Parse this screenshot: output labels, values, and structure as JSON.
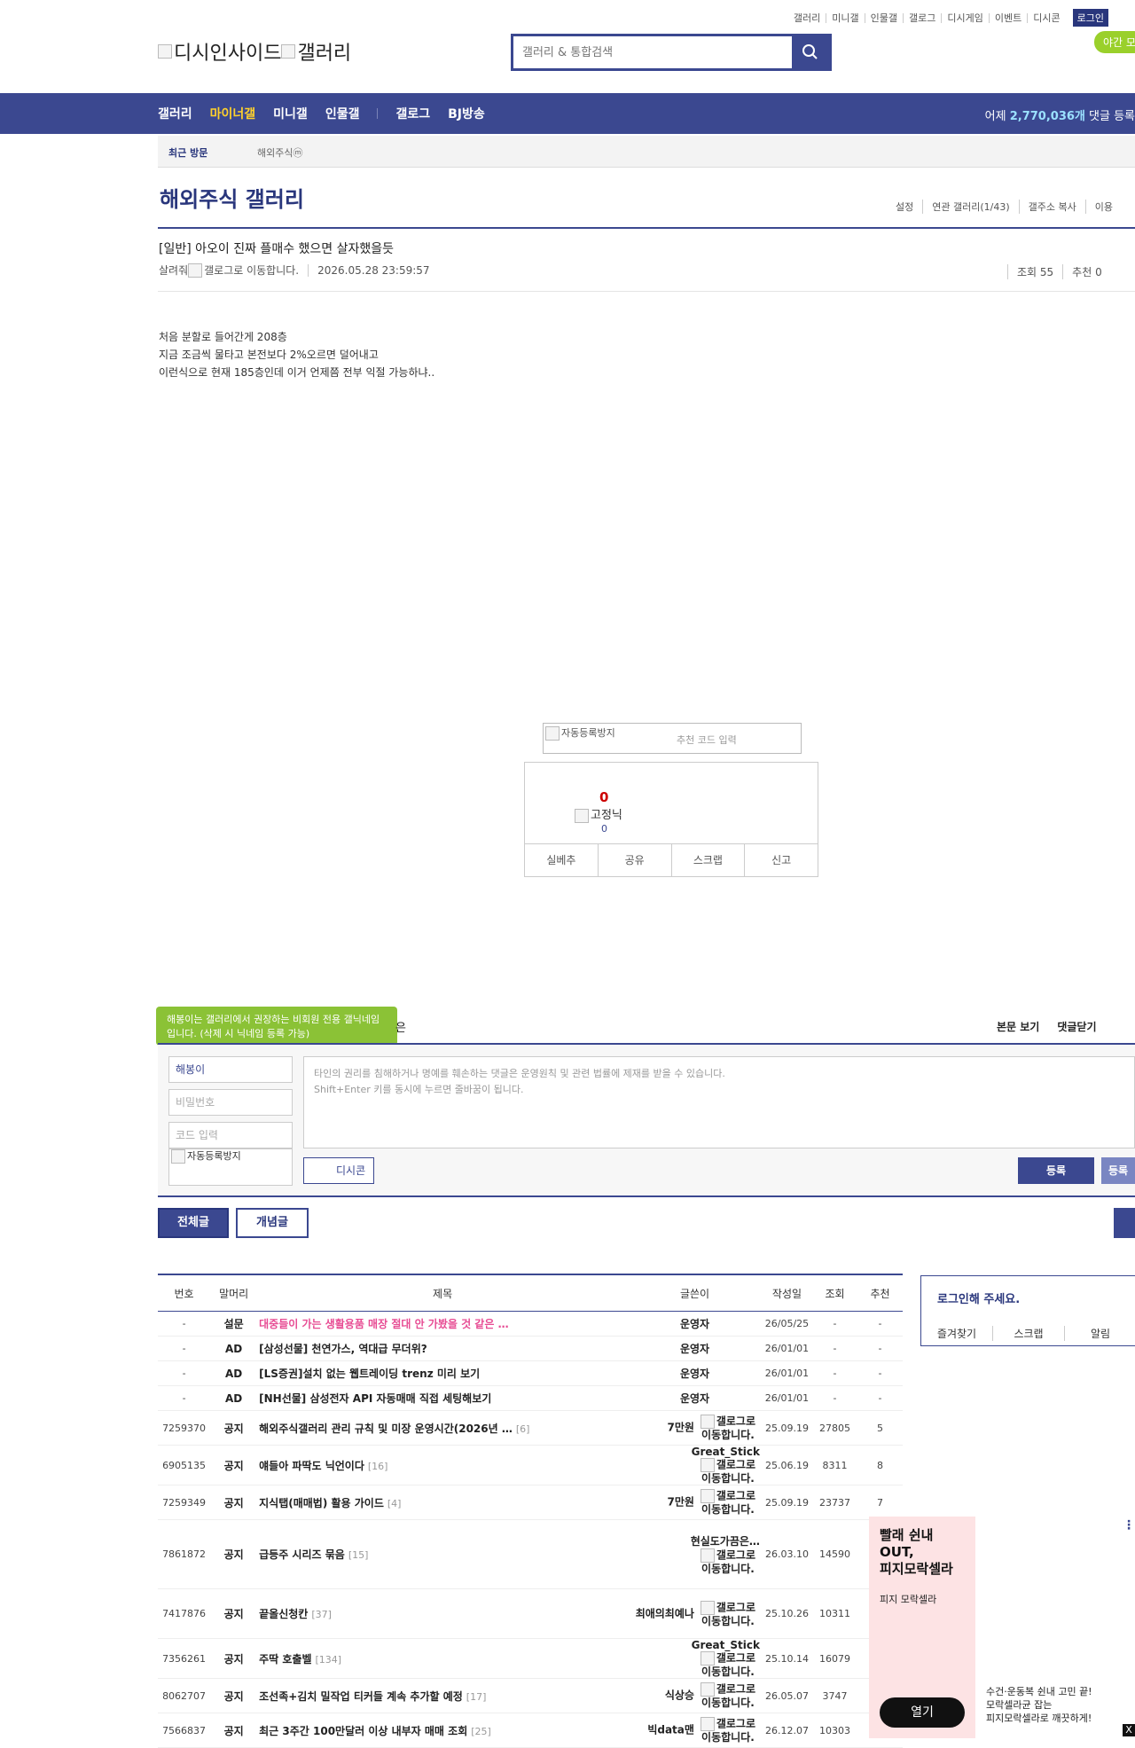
{
  "util_links": [
    "갤러리",
    "미니갤",
    "인물갤",
    "갤로그",
    "디시게임",
    "이벤트",
    "디시콘"
  ],
  "login_label": "로그인",
  "night_mode": "야간 모",
  "logo": {
    "left": "디시인사이드",
    "right": "갤러리"
  },
  "search": {
    "placeholder": "갤러리 & 통합검색"
  },
  "gnb": {
    "items": [
      "갤러리",
      "마이너갤",
      "미니갤",
      "인물갤",
      "갤로그",
      "BJ방송"
    ],
    "active": "마이너갤",
    "count_prefix": "어제 ",
    "count_value": "2,770,036개",
    "count_suffix": " 댓글 등록"
  },
  "recent_visit": {
    "label": "최근 방문",
    "gallery": "해외주식ⓜ"
  },
  "gallery": {
    "title": "해외주식 갤러리",
    "options": [
      "설정",
      "연관 갤러리(1/43)",
      "갤주소 복사",
      "이용"
    ]
  },
  "post": {
    "title": "[일반] 아오이 진짜 플매수 했으면 살자했을듯",
    "author": "살려줘",
    "author_icon_alt": "갤로그로 이동합니다.",
    "date": "2026.05.28 23:59:57",
    "views": "조회 55",
    "recommends": "추천 0",
    "body": [
      "처음 분할로 들어간게 208층",
      "지금 조금씩 물타고 본전보다 2%오르면 덜어내고",
      "이런식으로 현재 185층인데 이거 언제쯤 전부 익절 가능하냐.."
    ]
  },
  "captcha": {
    "img_alt": "자동등록방지",
    "placeholder": "추천 코드 입력"
  },
  "recommend": {
    "count": "0",
    "fixed_label": "고정닉",
    "fixed_count": "0",
    "buttons": [
      "실베추",
      "공유",
      "스크랩",
      "신고"
    ]
  },
  "comment": {
    "tooltip": "해봉이는 갤러리에서 권장하는 비회원 전용 갤닉네임입니다. (삭제 시 닉네임 등록 가능)",
    "tail": "은",
    "right_links": [
      "본문 보기",
      "댓글닫기"
    ],
    "nickname_value": "해봉이",
    "password_placeholder": "비밀번호",
    "code_placeholder": "코드 입력",
    "captcha_alt": "자동등록방지",
    "textarea_line1": "타인의 권리를 침해하거나 명예를 훼손하는 댓글은 운영원칙 및 관련 법률에 제재를 받을 수 있습니다.",
    "textarea_line2": "Shift+Enter 키를 동시에 누르면 줄바꿈이 됩니다.",
    "dccon_label": "디시콘",
    "register_label": "등록",
    "register2_label": "등록"
  },
  "list_tabs": {
    "all": "전체글",
    "concept": "개념글"
  },
  "list": {
    "headers": [
      "번호",
      "말머리",
      "제목",
      "글쓴이",
      "작성일",
      "조회",
      "추천"
    ],
    "rows": [
      {
        "no": "-",
        "head": "설문",
        "subject": "대중들이 가는 생활용품 매장 절대 안 가봤을 것 같은 …",
        "reply": "",
        "writer": "운영자",
        "date": "26/05/25",
        "views": "-",
        "rec": "-",
        "pink": true
      },
      {
        "no": "-",
        "head": "AD",
        "subject": "[삼성선물] 천연가스, 역대급 무더위?",
        "reply": "",
        "writer": "운영자",
        "date": "26/01/01",
        "views": "-",
        "rec": "-"
      },
      {
        "no": "-",
        "head": "AD",
        "subject": "[LS증권]설치 없는 웹트레이딩 trenz 미리 보기",
        "reply": "",
        "writer": "운영자",
        "date": "26/01/01",
        "views": "-",
        "rec": "-"
      },
      {
        "no": "-",
        "head": "AD",
        "subject": "[NH선물] 삼성전자 API 자동매매 직접 세팅해보기",
        "reply": "",
        "writer": "운영자",
        "date": "26/01/01",
        "views": "-",
        "rec": "-"
      },
      {
        "no": "7259370",
        "head": "공지",
        "subject": "해외주식갤러리 관리 규칙 및 미장 운영시간(2026년 …",
        "reply": "[6]",
        "writer": "7만원",
        "gallog": "갤로그로 이동합니다.",
        "date": "25.09.19",
        "views": "27805",
        "rec": "5"
      },
      {
        "no": "6905135",
        "head": "공지",
        "subject": "얘들아 파딱도 닉언이다",
        "reply": "[16]",
        "writer": "Great_Stick",
        "gallog": "갤로그로 이동합니다.",
        "date": "25.06.19",
        "views": "8311",
        "rec": "8"
      },
      {
        "no": "7259349",
        "head": "공지",
        "subject": "지식탭(매매법) 활용 가이드",
        "reply": "[4]",
        "writer": "7만원",
        "gallog": "갤로그로 이동합니다.",
        "date": "25.09.19",
        "views": "23737",
        "rec": "7"
      },
      {
        "no": "7861872",
        "head": "공지",
        "subject": "급등주 시리즈 묶음",
        "reply": "[15]",
        "writer": "현실도가끔은…",
        "gallog": "갤로그로 이동합니다.",
        "date": "26.03.10",
        "views": "14590",
        "rec": ""
      },
      {
        "no": "7417876",
        "head": "공지",
        "subject": "끝올신청칸",
        "reply": "[37]",
        "writer": "최애의최예나",
        "gallog": "갤로그로 이동합니다.",
        "date": "25.10.26",
        "views": "10311",
        "rec": ""
      },
      {
        "no": "7356261",
        "head": "공지",
        "subject": "주딱 호출벨",
        "reply": "[134]",
        "writer": "Great_Stick",
        "gallog": "갤로그로 이동합니다.",
        "date": "25.10.14",
        "views": "16079",
        "rec": ""
      },
      {
        "no": "8062707",
        "head": "공지",
        "subject": "조선족+김치 밀작업 티커들 계속 추가할 예정",
        "reply": "[17]",
        "writer": "식상승",
        "gallog": "갤로그로 이동합니다.",
        "date": "26.05.07",
        "views": "3747",
        "rec": ""
      },
      {
        "no": "7566837",
        "head": "공지",
        "subject": "최근 3주간 100만달러 이상 내부자 매매 조회",
        "reply": "[25]",
        "writer": "빅data맨",
        "gallog": "갤로그로 이동합니다.",
        "date": "26.12.07",
        "views": "10303",
        "rec": ""
      }
    ]
  },
  "login_box": {
    "title": "로그인해 주세요.",
    "links": [
      "즐겨찾기",
      "스크랩",
      "알림"
    ]
  },
  "ad": {
    "headline": "빨래 쉰내\nOUT,\n피지모락셀라",
    "brand": "피지 모락셀라",
    "open_label": "열기",
    "side_text": "수건·운동복 쉰내 고민 끝!\n모락셀라균 잡는\n피지모락셀라로 깨끗하게!",
    "more_icon": "⋮",
    "close_label": "X"
  },
  "colors": {
    "brand": "#3b4890",
    "active_menu": "#ffd12b",
    "pink_subject": "#e74b93",
    "green_badge": "#9ad02b"
  }
}
